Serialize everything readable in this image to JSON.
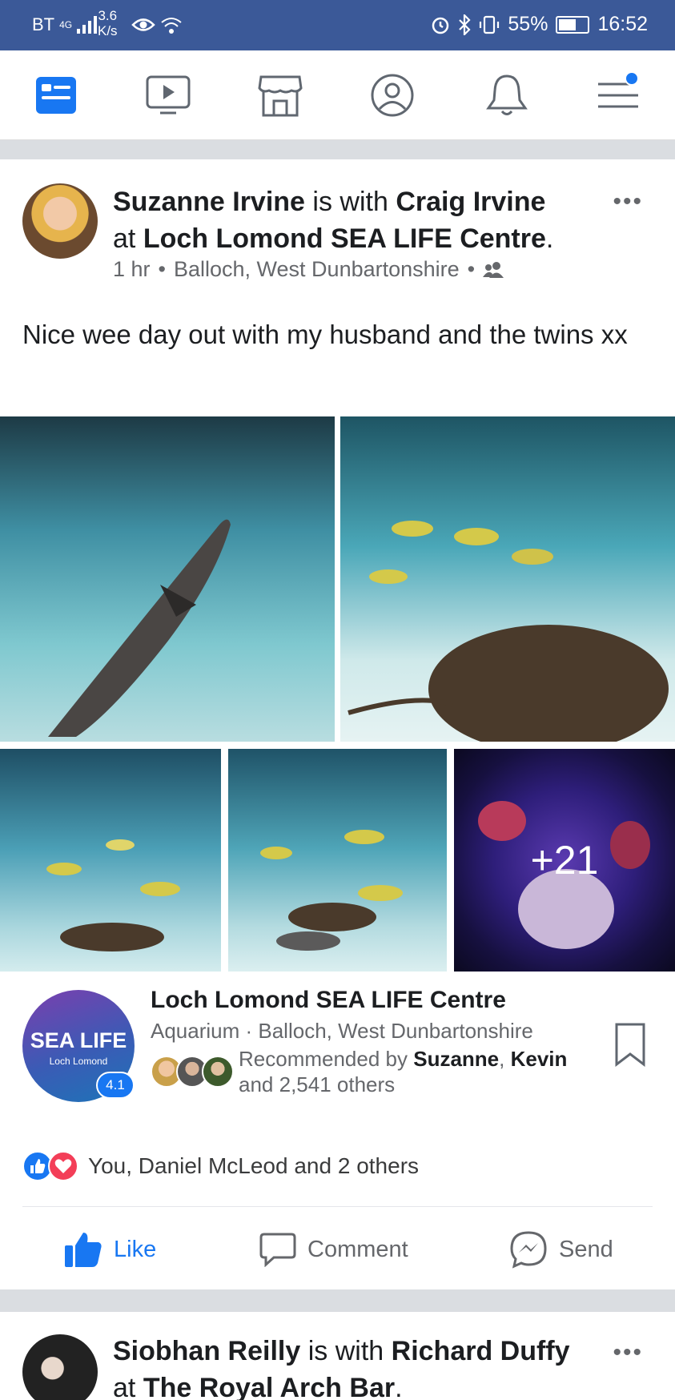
{
  "status_bar": {
    "carrier": "BT",
    "network": "4G",
    "speed_value": "3.6",
    "speed_unit": "K/s",
    "battery": "55%",
    "time": "16:52"
  },
  "nav": {
    "items": [
      "news-feed",
      "watch",
      "marketplace",
      "profile",
      "notifications",
      "menu"
    ],
    "active": "news-feed",
    "menu_has_badge": true
  },
  "post": {
    "author": "Suzanne Irvine",
    "with_text": "is with",
    "with_person": "Craig Irvine",
    "at_text": "at",
    "location_name": "Loch Lomond SEA LIFE Centre",
    "period": ".",
    "time": "1 hr",
    "location_meta": "Balloch, West Dunbartonshire",
    "audience_icon": "friends-icon",
    "more_label": "•••",
    "text": "Nice wee day out with my husband and the twins xx",
    "photos_overflow": "+21"
  },
  "page_card": {
    "logo_text": "SEA LIFE",
    "logo_sub": "Loch Lomond",
    "rating": "4.1",
    "name": "Loch Lomond SEA LIFE Centre",
    "category": "Aquarium · Balloch, West Dunbartonshire",
    "rec_prefix": "Recommended by ",
    "rec_name1": "Suzanne",
    "rec_sep": ", ",
    "rec_name2": "Kevin",
    "rec_suffix": "and 2,541 others"
  },
  "reactions": {
    "text": "You, Daniel McLeod and 2 others"
  },
  "actions": {
    "like": "Like",
    "comment": "Comment",
    "send": "Send"
  },
  "next_post": {
    "author": "Siobhan Reilly",
    "with_text": "is with",
    "with_person": "Richard Duffy",
    "at_text": "at",
    "location_name": "The Royal Arch Bar",
    "period": ".",
    "more_label": "•••"
  },
  "colors": {
    "status_bar": "#3b5998",
    "accent": "#1877f2",
    "love": "#f33e58"
  }
}
